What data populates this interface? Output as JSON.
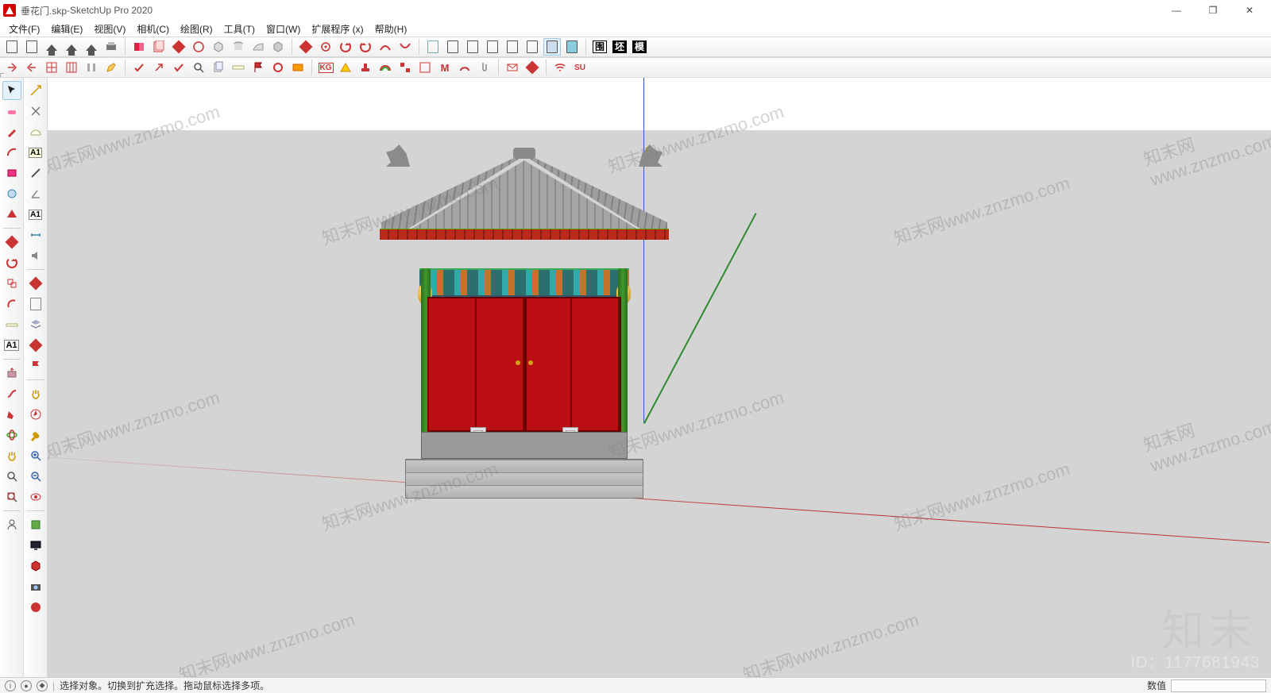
{
  "titlebar": {
    "filename": "垂花门.skp",
    "appname": "SketchUp Pro 2020",
    "separator": " - "
  },
  "window_controls": {
    "min": "—",
    "max": "❐",
    "close": "✕"
  },
  "menu": {
    "file": "文件(F)",
    "edit": "编辑(E)",
    "view": "视图(V)",
    "camera": "相机(C)",
    "draw": "绘图(R)",
    "tools": "工具(T)",
    "window": "窗口(W)",
    "ext": "扩展程序 (x)",
    "help": "帮助(H)"
  },
  "top_toolbar_groups": {
    "a": [
      "new",
      "open",
      "save",
      "cut",
      "house1",
      "house2"
    ],
    "b": [
      "book",
      "pages",
      "pushpull",
      "orbit",
      "box3d",
      "cyl",
      "sheet",
      "poly"
    ],
    "c": [
      "diamond",
      "target",
      "cycle",
      "cycle2",
      "curve",
      "curve2"
    ],
    "d": [
      "page1",
      "page2",
      "page3",
      "page4",
      "page5",
      "page6",
      "page7",
      "page8"
    ],
    "txt": [
      "围",
      "坯",
      "模"
    ]
  },
  "second_toolbar": [
    "arrow-out",
    "arrow-in",
    "grid",
    "grid2",
    "pillars",
    "edit",
    "sep",
    "check-red",
    "arrow-ne",
    "check2",
    "zoom",
    "copy",
    "ruler",
    "redflag",
    "redcirc",
    "orange",
    "sep",
    "kg",
    "tri",
    "stamp",
    "rainbow",
    "squares",
    "grid3",
    "gridM",
    "pipe",
    "clip",
    "sep",
    "mail",
    "diamond2",
    "sep",
    "wifi",
    "su"
  ],
  "left_col1": [
    "select",
    "eraser",
    "pencil",
    "arc",
    "rect",
    "circle",
    "triangle",
    "move",
    "rotate",
    "scale",
    "offset",
    "tape",
    "text",
    "pushpull",
    "followme",
    "paint",
    "orbit",
    "pan",
    "zoom",
    "zoom-ext",
    "sep",
    "person"
  ],
  "left_col2": [
    "dart",
    "scissors",
    "protractor",
    "A1",
    "knife",
    "angle",
    "A1b",
    "dims",
    "speaker",
    "sep",
    "diamond",
    "page",
    "stack",
    "diamond2",
    "redflag",
    "sep",
    "hand",
    "compass",
    "wrench",
    "zoomplus",
    "zoomminus",
    "eye",
    "sep",
    "book",
    "monitor",
    "cube",
    "camera",
    "badge"
  ],
  "statusbar": {
    "hint": "选择对象。切换到扩充选择。拖动鼠标选择多项。",
    "value_label": "数值"
  },
  "watermark": {
    "site": "知末网www.znzmo.com",
    "brand": "知末",
    "id": "ID：1177681943"
  }
}
